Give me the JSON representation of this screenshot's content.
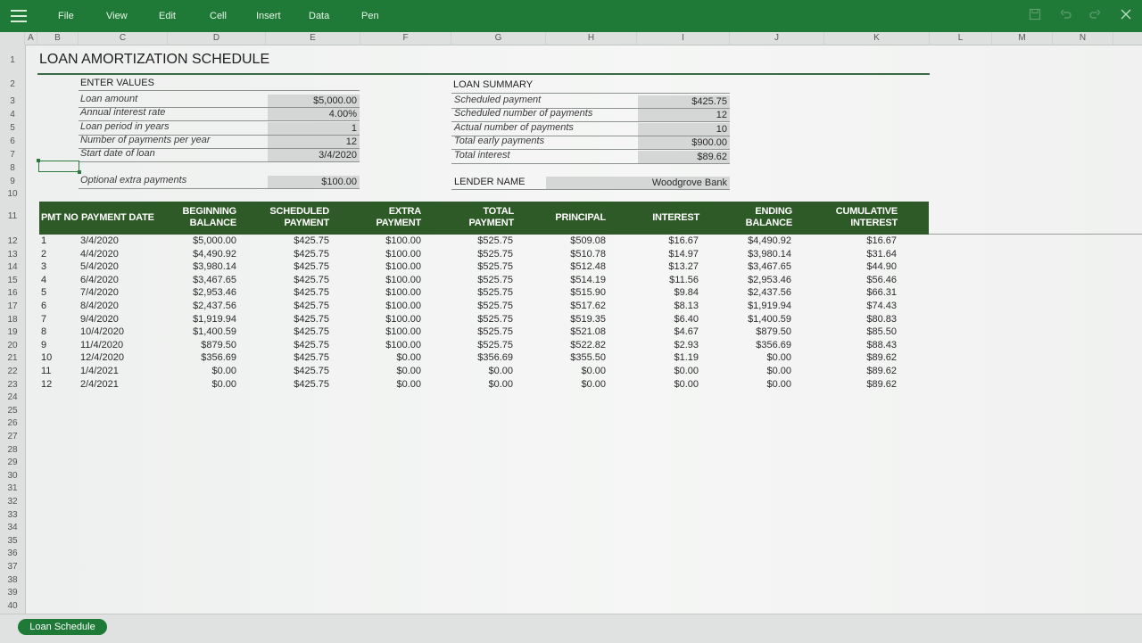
{
  "menu": {
    "file": "File",
    "view": "View",
    "edit": "Edit",
    "cell": "Cell",
    "insert": "Insert",
    "data": "Data",
    "pen": "Pen"
  },
  "columns": [
    "A",
    "B",
    "C",
    "D",
    "E",
    "F",
    "G",
    "H",
    "I",
    "J",
    "K",
    "L",
    "M",
    "N"
  ],
  "rows": [
    "1",
    "2",
    "3",
    "4",
    "5",
    "6",
    "7",
    "8",
    "9",
    "10",
    "11",
    "12",
    "13",
    "14",
    "15",
    "16",
    "17",
    "18",
    "19",
    "20",
    "21",
    "22",
    "23",
    "24",
    "25",
    "26",
    "27",
    "28",
    "29",
    "30",
    "31",
    "32",
    "33",
    "34",
    "35",
    "36",
    "37",
    "38",
    "39",
    "40"
  ],
  "title": "LOAN AMORTIZATION SCHEDULE",
  "enter_values": {
    "heading": "ENTER VALUES",
    "items": [
      {
        "label": "Loan amount",
        "value": "$5,000.00"
      },
      {
        "label": "Annual interest rate",
        "value": "4.00%"
      },
      {
        "label": "Loan period in years",
        "value": "1"
      },
      {
        "label": "Number of payments per year",
        "value": "12"
      },
      {
        "label": "Start date of loan",
        "value": "3/4/2020"
      }
    ],
    "extra": {
      "label": "Optional extra payments",
      "value": "$100.00"
    }
  },
  "loan_summary": {
    "heading": "LOAN SUMMARY",
    "items": [
      {
        "label": "Scheduled payment",
        "value": "$425.75"
      },
      {
        "label": "Scheduled number of payments",
        "value": "12"
      },
      {
        "label": "Actual number of payments",
        "value": "10"
      },
      {
        "label": "Total early payments",
        "value": "$900.00"
      },
      {
        "label": "Total interest",
        "value": "$89.62"
      }
    ],
    "lender_label": "LENDER NAME",
    "lender_value": "Woodgrove Bank"
  },
  "table": {
    "headers": {
      "pmt_no": "PMT NO",
      "payment_date": "PAYMENT DATE",
      "beginning_balance_1": "BEGINNING",
      "beginning_balance_2": "BALANCE",
      "scheduled_payment_1": "SCHEDULED",
      "scheduled_payment_2": "PAYMENT",
      "extra_payment_1": "EXTRA",
      "extra_payment_2": "PAYMENT",
      "total_payment_1": "TOTAL",
      "total_payment_2": "PAYMENT",
      "principal": "PRINCIPAL",
      "interest": "INTEREST",
      "ending_balance_1": "ENDING",
      "ending_balance_2": "BALANCE",
      "cumulative_interest_1": "CUMULATIVE",
      "cumulative_interest_2": "INTEREST"
    },
    "rows": [
      {
        "no": "1",
        "date": "3/4/2020",
        "begin": "$5,000.00",
        "sched": "$425.75",
        "extra": "$100.00",
        "total": "$525.75",
        "principal": "$509.08",
        "interest": "$16.67",
        "ending": "$4,490.92",
        "cumint": "$16.67"
      },
      {
        "no": "2",
        "date": "4/4/2020",
        "begin": "$4,490.92",
        "sched": "$425.75",
        "extra": "$100.00",
        "total": "$525.75",
        "principal": "$510.78",
        "interest": "$14.97",
        "ending": "$3,980.14",
        "cumint": "$31.64"
      },
      {
        "no": "3",
        "date": "5/4/2020",
        "begin": "$3,980.14",
        "sched": "$425.75",
        "extra": "$100.00",
        "total": "$525.75",
        "principal": "$512.48",
        "interest": "$13.27",
        "ending": "$3,467.65",
        "cumint": "$44.90"
      },
      {
        "no": "4",
        "date": "6/4/2020",
        "begin": "$3,467.65",
        "sched": "$425.75",
        "extra": "$100.00",
        "total": "$525.75",
        "principal": "$514.19",
        "interest": "$11.56",
        "ending": "$2,953.46",
        "cumint": "$56.46"
      },
      {
        "no": "5",
        "date": "7/4/2020",
        "begin": "$2,953.46",
        "sched": "$425.75",
        "extra": "$100.00",
        "total": "$525.75",
        "principal": "$515.90",
        "interest": "$9.84",
        "ending": "$2,437.56",
        "cumint": "$66.31"
      },
      {
        "no": "6",
        "date": "8/4/2020",
        "begin": "$2,437.56",
        "sched": "$425.75",
        "extra": "$100.00",
        "total": "$525.75",
        "principal": "$517.62",
        "interest": "$8.13",
        "ending": "$1,919.94",
        "cumint": "$74.43"
      },
      {
        "no": "7",
        "date": "9/4/2020",
        "begin": "$1,919.94",
        "sched": "$425.75",
        "extra": "$100.00",
        "total": "$525.75",
        "principal": "$519.35",
        "interest": "$6.40",
        "ending": "$1,400.59",
        "cumint": "$80.83"
      },
      {
        "no": "8",
        "date": "10/4/2020",
        "begin": "$1,400.59",
        "sched": "$425.75",
        "extra": "$100.00",
        "total": "$525.75",
        "principal": "$521.08",
        "interest": "$4.67",
        "ending": "$879.50",
        "cumint": "$85.50"
      },
      {
        "no": "9",
        "date": "11/4/2020",
        "begin": "$879.50",
        "sched": "$425.75",
        "extra": "$100.00",
        "total": "$525.75",
        "principal": "$522.82",
        "interest": "$2.93",
        "ending": "$356.69",
        "cumint": "$88.43"
      },
      {
        "no": "10",
        "date": "12/4/2020",
        "begin": "$356.69",
        "sched": "$425.75",
        "extra": "$0.00",
        "total": "$356.69",
        "principal": "$355.50",
        "interest": "$1.19",
        "ending": "$0.00",
        "cumint": "$89.62"
      },
      {
        "no": "11",
        "date": "1/4/2021",
        "begin": "$0.00",
        "sched": "$425.75",
        "extra": "$0.00",
        "total": "$0.00",
        "principal": "$0.00",
        "interest": "$0.00",
        "ending": "$0.00",
        "cumint": "$89.62"
      },
      {
        "no": "12",
        "date": "2/4/2021",
        "begin": "$0.00",
        "sched": "$425.75",
        "extra": "$0.00",
        "total": "$0.00",
        "principal": "$0.00",
        "interest": "$0.00",
        "ending": "$0.00",
        "cumint": "$89.62"
      }
    ]
  },
  "sheet_tab": "Loan Schedule",
  "colors": {
    "ribbon": "#1f7a38",
    "table_header": "#2d5a26",
    "input_cell": "#d4d7d5"
  },
  "icons": [
    "hamburger-icon",
    "save-icon",
    "undo-icon",
    "redo-icon",
    "close-icon"
  ]
}
